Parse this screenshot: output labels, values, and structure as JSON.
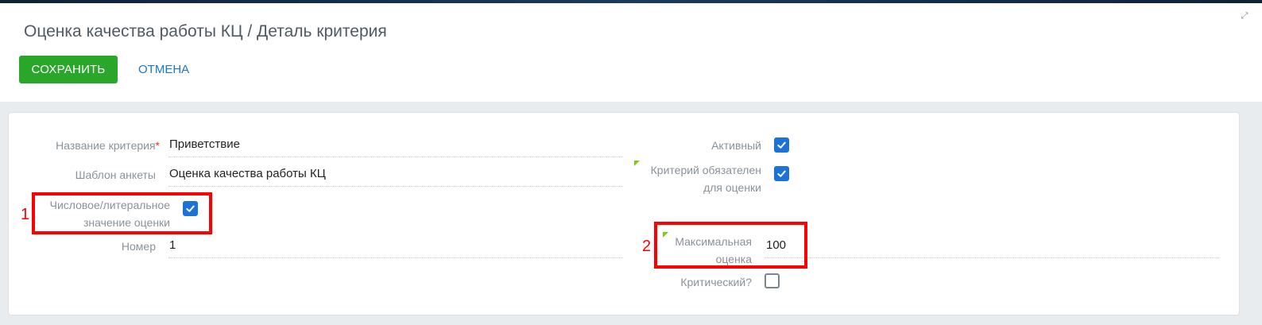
{
  "header": {
    "title": "Оценка качества работы КЦ / Деталь критерия",
    "save_label": "СОХРАНИТЬ",
    "cancel_label": "ОТМЕНА"
  },
  "form": {
    "criterion_name": {
      "label": "Название критерия",
      "required_mark": "*",
      "value": "Приветствие"
    },
    "template": {
      "label": "Шаблон анкеты",
      "value": "Оценка качества работы КЦ"
    },
    "numeric_value": {
      "label_line1": "Числовое/литеральное",
      "label_line2": "значение оценки",
      "checked": true
    },
    "number": {
      "label": "Номер",
      "value": "1"
    },
    "active": {
      "label": "Активный",
      "checked": true
    },
    "mandatory": {
      "label_line1": "Критерий обязателен",
      "label_line2": "для оценки",
      "checked": true
    },
    "max_score": {
      "label_line1": "Максимальная",
      "label_line2": "оценка",
      "value": "100"
    },
    "critical": {
      "label": "Критический?",
      "checked": false
    }
  },
  "annotations": {
    "marker1": "1",
    "marker2": "2"
  },
  "colors": {
    "save_button": "#2aa62a",
    "cancel_link": "#1a78c8",
    "checkbox_checked": "#1c73d5",
    "annotation": "#ff0000",
    "required": "#e2382b"
  },
  "icons": [
    "expand-icon",
    "checkmark-icon"
  ]
}
